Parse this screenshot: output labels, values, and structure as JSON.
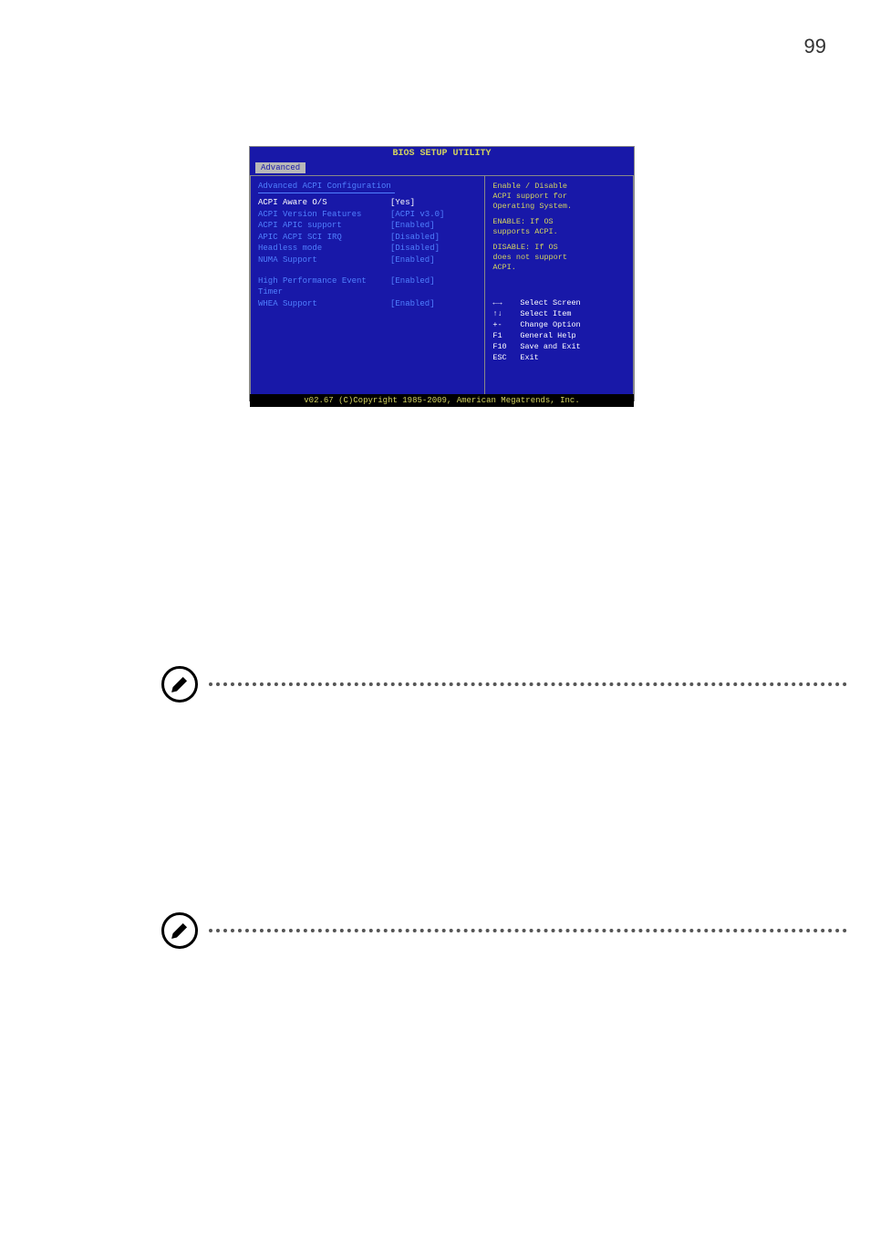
{
  "page_number": "99",
  "bios": {
    "header": "BIOS SETUP UTILITY",
    "tab": "Advanced",
    "section_title": "Advanced ACPI Configuration",
    "items": [
      {
        "label": "ACPI Aware O/S",
        "value": "[Yes]",
        "highlighted": true
      },
      {
        "label": "ACPI Version Features",
        "value": "[ACPI v3.0]",
        "highlighted": false
      },
      {
        "label": "ACPI APIC support",
        "value": "[Enabled]",
        "highlighted": false
      },
      {
        "label": "APIC ACPI SCI IRQ",
        "value": "[Disabled]",
        "highlighted": false
      },
      {
        "label": "Headless mode",
        "value": "[Disabled]",
        "highlighted": false
      },
      {
        "label": "NUMA Support",
        "value": "[Enabled]",
        "highlighted": false
      }
    ],
    "items2": [
      {
        "label": "High Performance Event Timer",
        "value": "[Enabled]",
        "highlighted": false
      },
      {
        "label": "WHEA Support",
        "value": "[Enabled]",
        "highlighted": false
      }
    ],
    "help": {
      "line1": "Enable / Disable",
      "line2": "ACPI support for",
      "line3": "Operating System.",
      "line4": "ENABLE: If OS",
      "line5": "supports ACPI.",
      "line6": "DISABLE: If OS",
      "line7": "does not support",
      "line8": "ACPI."
    },
    "nav": [
      {
        "key": "←→",
        "desc": "Select Screen"
      },
      {
        "key": "↑↓",
        "desc": "Select Item"
      },
      {
        "key": "+-",
        "desc": "Change Option"
      },
      {
        "key": "F1",
        "desc": "General Help"
      },
      {
        "key": "F10",
        "desc": "Save and Exit"
      },
      {
        "key": "ESC",
        "desc": "Exit"
      }
    ],
    "footer": "v02.67 (C)Copyright 1985-2009, American Megatrends, Inc."
  }
}
